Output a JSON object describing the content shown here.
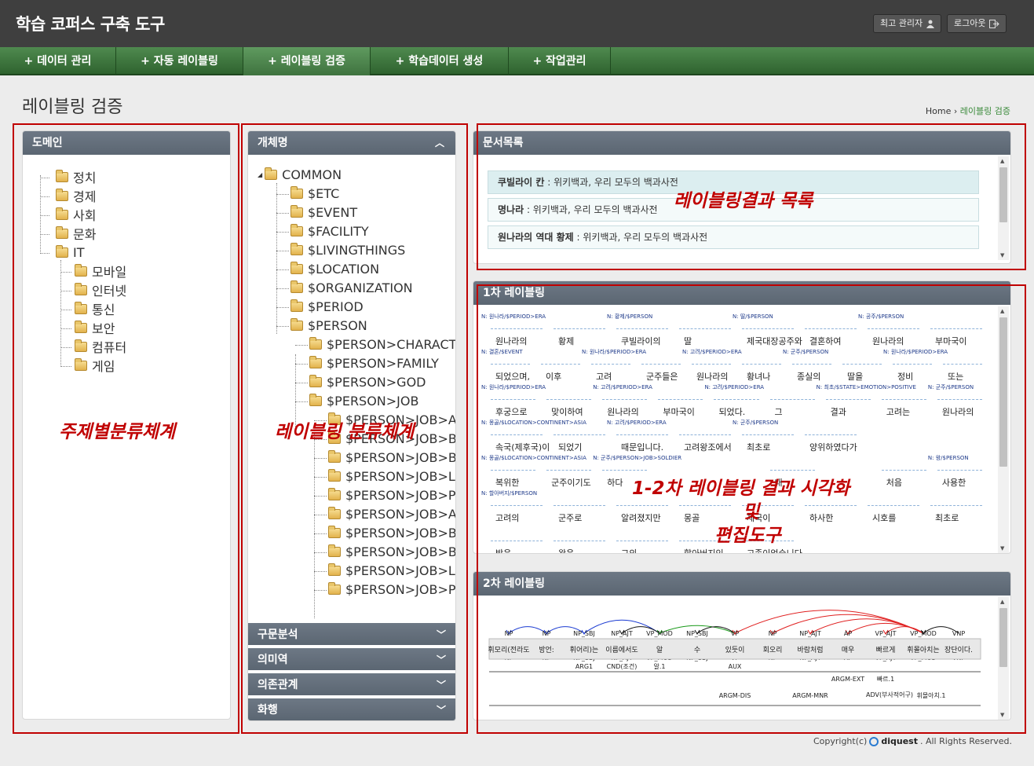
{
  "header": {
    "title": "학습 코퍼스 구축 도구",
    "user_label": "최고 관리자",
    "logout_label": "로그아웃"
  },
  "nav": {
    "items": [
      {
        "label": "+ 데이터 관리"
      },
      {
        "label": "+ 자동 레이블링"
      },
      {
        "label": "+ 레이블링 검증"
      },
      {
        "label": "+ 학습데이터 생성"
      },
      {
        "label": "+ 작업관리"
      }
    ]
  },
  "page": {
    "title": "레이블링 검증",
    "breadcrumb_home": "Home",
    "breadcrumb_current": "레이블링 검증"
  },
  "domain_panel": {
    "title": "도메인",
    "items": [
      "정치",
      "경제",
      "사회",
      "문화",
      "IT"
    ],
    "it_children": [
      "모바일",
      "인터넷",
      "통신",
      "보안",
      "컴퓨터",
      "게임"
    ]
  },
  "entity_panel": {
    "title": "개체명",
    "root": "COMMON",
    "items": [
      "$ETC",
      "$EVENT",
      "$FACILITY",
      "$LIVINGTHINGS",
      "$LOCATION",
      "$ORGANIZATION",
      "$PERIOD",
      "$PERSON"
    ],
    "person_children": [
      "$PERSON>CHARACTER",
      "$PERSON>FAMILY",
      "$PERSON>GOD",
      "$PERSON>JOB"
    ],
    "job_children": [
      "$PERSON>JOB>ART",
      "$PERSON>JOB>BRO",
      "$PERSON>JOB>BUS",
      "$PERSON>JOB>LAW",
      "$PERSON>JOB>POLI",
      "$PERSON>JOB>ARTI",
      "$PERSON>JOB>BRO",
      "$PERSON>JOB>BUSI",
      "$PERSON>JOB>LAW",
      "$PERSON>JOB>POLI"
    ],
    "accordions": [
      "구문분석",
      "의미역",
      "의존관계",
      "화행"
    ]
  },
  "doc_panel": {
    "title": "문서목록",
    "docs": [
      {
        "name": "쿠빌라이 칸",
        "source": ": 위키백과, 우리 모두의 백과사전"
      },
      {
        "name": "명나라",
        "source": ": 위키백과, 우리 모두의 백과사전"
      },
      {
        "name": "원나라의 역대 황제",
        "source": ": 위키백과, 우리 모두의 백과사전"
      }
    ]
  },
  "label1_panel": {
    "title": "1차 레이블링",
    "rows": [
      [
        "원나라의",
        "황제",
        "쿠빌라이의",
        "딸",
        "제국대장공주와",
        "결혼하여",
        "원나라의",
        "부마국이"
      ],
      [
        "되었으며,",
        "이후",
        "고려",
        "군주들은",
        "원나라의",
        "황녀나",
        "종실의",
        "딸을",
        "정비",
        "또는"
      ],
      [
        "후궁으로",
        "맞이하여",
        "원나라의",
        "부마국이",
        "되었다.",
        "그",
        "결과",
        "고려는",
        "원나라의"
      ],
      [
        "속국(제후국)이",
        "되었기",
        "때문입니다.",
        "고려왕조에서",
        "최초로",
        "양위하였다가"
      ],
      [
        "복위한",
        "군주이기도",
        "하다",
        "",
        "",
        "내",
        "",
        "처음",
        "사용한"
      ],
      [
        "고려의",
        "군주로",
        "알려졌지만",
        "몽골",
        "제국이",
        "하사한",
        "시호를",
        "최초로"
      ],
      [
        "받은",
        "왕은",
        "그의",
        "할아버지인",
        "고종이었습니다."
      ]
    ],
    "ner_tags": [
      "N: 원나라/$PERIOD>ERA",
      "N: 황제/$PERSON",
      "N: 딸/$PERSON",
      "N: 공주/$PERSON",
      "N: 결혼/$EVENT",
      "N: 원나라/$PERIOD>ERA",
      "N: 고려/$PERIOD>ERA",
      "N: 군주/$PERSON",
      "N: 원나라/$PERIOD>ERA",
      "N: 원나라/$PERIOD>ERA",
      "N: 고려/$PERIOD>ERA",
      "N: 고려/$PERIOD>ERA",
      "N: 최초/$STATE>EMOTION>POSITIVE",
      "N: 군주/$PERSON",
      "N: 몽골/$LOCATION>CONTINENT>ASIA",
      "N: 고려/$PERIOD>ERA",
      "N: 군주/$PERSON",
      "N: 몽골/$LOCATION>CONTINENT>ASIA",
      "N: 군주/$PERSON>JOB>SOLDIER",
      "N: 왕/$PERSON",
      "N: 할아버지/$PERSON"
    ]
  },
  "label2_panel": {
    "title": "2차 레이블링",
    "dep_tags": [
      "NP",
      "NP",
      "NP_SBJ",
      "NP_AJT",
      "VP_MOD",
      "NP_SBJ",
      "VP",
      "NP",
      "NP_AJT",
      "AP",
      "VP_AJT",
      "VP_MOD",
      "VNP"
    ],
    "words": [
      "휘모리(전라도",
      "방언:",
      "휘어리)는",
      "이름에서도",
      "알",
      "수",
      "있듯이",
      "회오리",
      "바람처럼",
      "매우",
      "빠르게",
      "휘몰아치는",
      "장단이다."
    ],
    "srl": [
      "ARG1",
      "CND(조건)",
      "알.1",
      "AUX",
      "ARGM-EXT",
      "빠르.1",
      "ARGM-DIS",
      "ARGM-MNR",
      "ADV(부사적어구)",
      "휘몰아치.1"
    ]
  },
  "annotations": {
    "a1": "주제별분류체계",
    "a2": "레이블링 분류체계",
    "a3": "레이블링결과 목록",
    "a4_line1": "1-2차 레이블링 결과 시각화",
    "a4_line2": "및",
    "a4_line3": "편집도구"
  },
  "footer": {
    "copyright": "Copyright(c)",
    "brand": "diquest",
    "rights": ". All Rights Reserved."
  }
}
